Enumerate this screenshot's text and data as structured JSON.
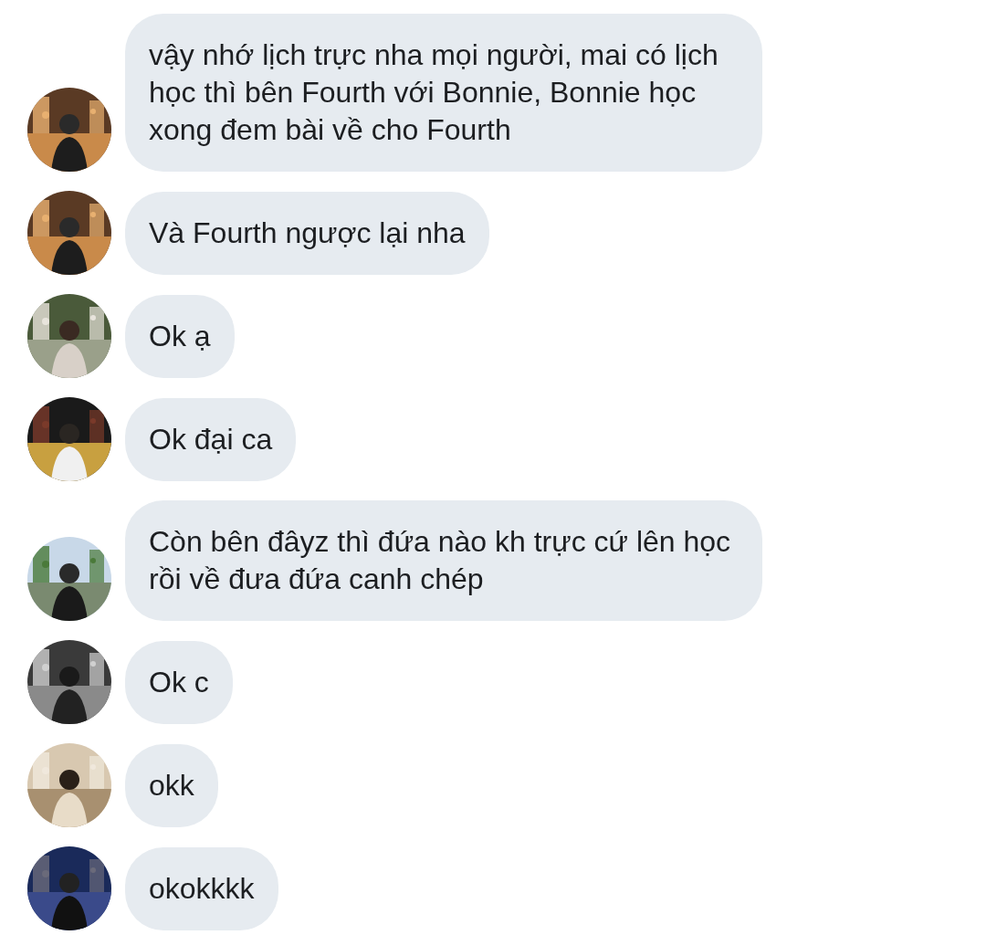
{
  "messages": [
    {
      "text": "vậy nhớ lịch trực nha mọi người, mai có lịch học thì bên Fourth với Bonnie, Bonnie học xong đem bài về cho Fourth"
    },
    {
      "text": "Và Fourth ngược lại nha"
    },
    {
      "text": "Ok ạ"
    },
    {
      "text": "Ok đại ca"
    },
    {
      "text": "Còn bên đâyz thì đứa nào kh trực cứ lên học rồi về đưa đứa canh chép"
    },
    {
      "text": "Ok c"
    },
    {
      "text": "okk"
    },
    {
      "text": "okokkkk"
    }
  ]
}
